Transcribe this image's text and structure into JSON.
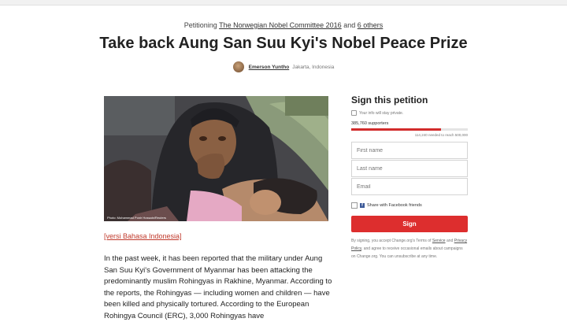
{
  "header": {
    "petitioning_prefix": "Petitioning",
    "target": "The Norwegian Nobel Committee 2016",
    "and": "and",
    "others": "6 others"
  },
  "petition": {
    "title": "Take back Aung San Suu Kyi's Nobel Peace Prize",
    "author_name": "Emerson Yuntho",
    "author_location": "Jakarta, Indonesia",
    "photo_credit": "Photo: Mohammad Ponir Hossain/Reuters",
    "translation_link": "[versi Bahasa Indonesia]",
    "body": "In the past week, it has been reported that the military under Aung San Suu Kyi's Government of Myanmar has been attacking the predominantly muslim Rohingyas in Rakhine, Myanmar. According to the reports, the Rohingyas — including women and children — have been killed and physically tortured. According to the European Rohingya Council (ERC), 3,000 Rohingyas have"
  },
  "sign": {
    "title": "Sign this petition",
    "privacy": "Your info will stay private.",
    "supporters": "385,760 supporters",
    "progress": 0.77,
    "goal": "114,240 needed to reach 500,000",
    "first_name_placeholder": "First name",
    "last_name_placeholder": "Last name",
    "email_placeholder": "Email",
    "facebook_label": "Share with Facebook friends",
    "button": "Sign",
    "terms_prefix": "By signing, you accept Change.org's Terms of",
    "terms_link": "Service",
    "terms_and": "and",
    "privacy_link": "Privacy Policy",
    "terms_suffix": ", and agree to receive occasional emails about campaigns on Change.org. You can unsubscribe at any time.",
    "colors": {
      "accent": "#dd2e2e",
      "progress": "#d22b2b",
      "facebook": "#3b5998"
    }
  }
}
